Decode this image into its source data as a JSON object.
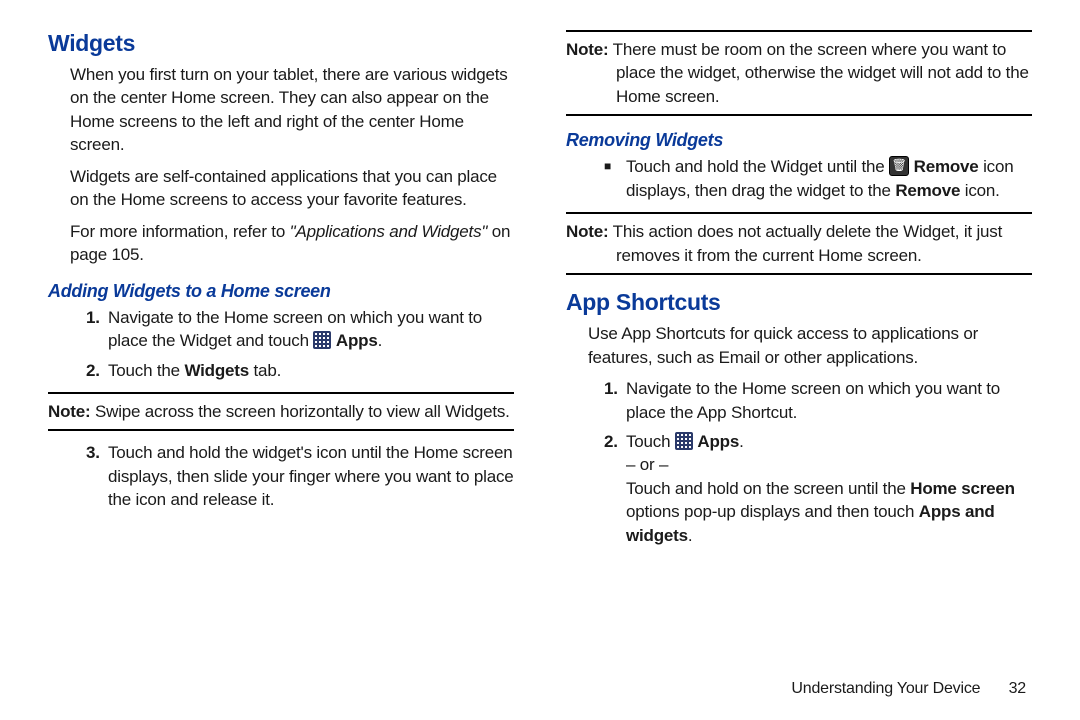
{
  "left": {
    "h1": "Widgets",
    "p1": "When you first turn on your tablet, there are various widgets on the center Home screen. They can also appear on the Home screens to the left and right of the center Home screen.",
    "p2": "Widgets are self-contained applications that you can place on the Home screens to access your favorite features.",
    "p3a": "For more information, refer to ",
    "p3ref": "\"Applications and Widgets\"",
    "p3b": " on page 105.",
    "sub1": "Adding Widgets to a Home screen",
    "s1_n1": "1.",
    "s1_t1a": "Navigate to the Home screen on which you want to place the Widget and touch ",
    "s1_apps": "Apps",
    "s1_t1b": ".",
    "s1_n2": "2.",
    "s1_t2a": "Touch the ",
    "s1_t2b": "Widgets",
    "s1_t2c": " tab.",
    "note_label": "Note:",
    "note_text": " Swipe across the screen horizontally to view all Widgets.",
    "s1_n3": "3.",
    "s1_t3": "Touch and hold the widget's icon until the Home screen displays, then slide your finger where you want to place the icon and release it."
  },
  "right": {
    "note1_label": "Note:",
    "note1_text": " There must be room on the screen where you want to place the widget, otherwise the widget will not add to the Home screen.",
    "sub1": "Removing Widgets",
    "rem_a": "Touch and hold the Widget until the ",
    "rem_b": "Remove",
    "rem_c": " icon displays, then drag the widget to the ",
    "rem_d": "Remove",
    "rem_e": " icon.",
    "note2_label": "Note:",
    "note2_text": " This action does not actually delete the Widget, it just removes it from the current Home screen.",
    "h1": "App Shortcuts",
    "p1": "Use App Shortcuts for quick access to applications or features, such as Email or other applications.",
    "n1": "1.",
    "t1": "Navigate to the Home screen on which you want to place the App Shortcut.",
    "n2": "2.",
    "t2a": "Touch ",
    "t2apps": "Apps",
    "t2b": ".",
    "or": "– or –",
    "t2c": "Touch and hold on the screen until the ",
    "t2hs": "Home screen",
    "t2d": " options pop-up displays and then touch ",
    "t2aw": "Apps and widgets",
    "t2e": ".",
    "footer_section": "Understanding Your Device",
    "footer_page": "32"
  }
}
